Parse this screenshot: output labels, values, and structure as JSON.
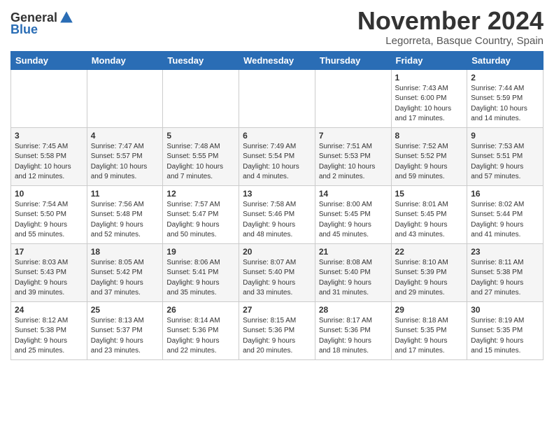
{
  "logo": {
    "general": "General",
    "blue": "Blue"
  },
  "title": "November 2024",
  "location": "Legorreta, Basque Country, Spain",
  "days_of_week": [
    "Sunday",
    "Monday",
    "Tuesday",
    "Wednesday",
    "Thursday",
    "Friday",
    "Saturday"
  ],
  "weeks": [
    [
      {
        "day": "",
        "info": ""
      },
      {
        "day": "",
        "info": ""
      },
      {
        "day": "",
        "info": ""
      },
      {
        "day": "",
        "info": ""
      },
      {
        "day": "",
        "info": ""
      },
      {
        "day": "1",
        "info": "Sunrise: 7:43 AM\nSunset: 6:00 PM\nDaylight: 10 hours\nand 17 minutes."
      },
      {
        "day": "2",
        "info": "Sunrise: 7:44 AM\nSunset: 5:59 PM\nDaylight: 10 hours\nand 14 minutes."
      }
    ],
    [
      {
        "day": "3",
        "info": "Sunrise: 7:45 AM\nSunset: 5:58 PM\nDaylight: 10 hours\nand 12 minutes."
      },
      {
        "day": "4",
        "info": "Sunrise: 7:47 AM\nSunset: 5:57 PM\nDaylight: 10 hours\nand 9 minutes."
      },
      {
        "day": "5",
        "info": "Sunrise: 7:48 AM\nSunset: 5:55 PM\nDaylight: 10 hours\nand 7 minutes."
      },
      {
        "day": "6",
        "info": "Sunrise: 7:49 AM\nSunset: 5:54 PM\nDaylight: 10 hours\nand 4 minutes."
      },
      {
        "day": "7",
        "info": "Sunrise: 7:51 AM\nSunset: 5:53 PM\nDaylight: 10 hours\nand 2 minutes."
      },
      {
        "day": "8",
        "info": "Sunrise: 7:52 AM\nSunset: 5:52 PM\nDaylight: 9 hours\nand 59 minutes."
      },
      {
        "day": "9",
        "info": "Sunrise: 7:53 AM\nSunset: 5:51 PM\nDaylight: 9 hours\nand 57 minutes."
      }
    ],
    [
      {
        "day": "10",
        "info": "Sunrise: 7:54 AM\nSunset: 5:50 PM\nDaylight: 9 hours\nand 55 minutes."
      },
      {
        "day": "11",
        "info": "Sunrise: 7:56 AM\nSunset: 5:48 PM\nDaylight: 9 hours\nand 52 minutes."
      },
      {
        "day": "12",
        "info": "Sunrise: 7:57 AM\nSunset: 5:47 PM\nDaylight: 9 hours\nand 50 minutes."
      },
      {
        "day": "13",
        "info": "Sunrise: 7:58 AM\nSunset: 5:46 PM\nDaylight: 9 hours\nand 48 minutes."
      },
      {
        "day": "14",
        "info": "Sunrise: 8:00 AM\nSunset: 5:45 PM\nDaylight: 9 hours\nand 45 minutes."
      },
      {
        "day": "15",
        "info": "Sunrise: 8:01 AM\nSunset: 5:45 PM\nDaylight: 9 hours\nand 43 minutes."
      },
      {
        "day": "16",
        "info": "Sunrise: 8:02 AM\nSunset: 5:44 PM\nDaylight: 9 hours\nand 41 minutes."
      }
    ],
    [
      {
        "day": "17",
        "info": "Sunrise: 8:03 AM\nSunset: 5:43 PM\nDaylight: 9 hours\nand 39 minutes."
      },
      {
        "day": "18",
        "info": "Sunrise: 8:05 AM\nSunset: 5:42 PM\nDaylight: 9 hours\nand 37 minutes."
      },
      {
        "day": "19",
        "info": "Sunrise: 8:06 AM\nSunset: 5:41 PM\nDaylight: 9 hours\nand 35 minutes."
      },
      {
        "day": "20",
        "info": "Sunrise: 8:07 AM\nSunset: 5:40 PM\nDaylight: 9 hours\nand 33 minutes."
      },
      {
        "day": "21",
        "info": "Sunrise: 8:08 AM\nSunset: 5:40 PM\nDaylight: 9 hours\nand 31 minutes."
      },
      {
        "day": "22",
        "info": "Sunrise: 8:10 AM\nSunset: 5:39 PM\nDaylight: 9 hours\nand 29 minutes."
      },
      {
        "day": "23",
        "info": "Sunrise: 8:11 AM\nSunset: 5:38 PM\nDaylight: 9 hours\nand 27 minutes."
      }
    ],
    [
      {
        "day": "24",
        "info": "Sunrise: 8:12 AM\nSunset: 5:38 PM\nDaylight: 9 hours\nand 25 minutes."
      },
      {
        "day": "25",
        "info": "Sunrise: 8:13 AM\nSunset: 5:37 PM\nDaylight: 9 hours\nand 23 minutes."
      },
      {
        "day": "26",
        "info": "Sunrise: 8:14 AM\nSunset: 5:36 PM\nDaylight: 9 hours\nand 22 minutes."
      },
      {
        "day": "27",
        "info": "Sunrise: 8:15 AM\nSunset: 5:36 PM\nDaylight: 9 hours\nand 20 minutes."
      },
      {
        "day": "28",
        "info": "Sunrise: 8:17 AM\nSunset: 5:36 PM\nDaylight: 9 hours\nand 18 minutes."
      },
      {
        "day": "29",
        "info": "Sunrise: 8:18 AM\nSunset: 5:35 PM\nDaylight: 9 hours\nand 17 minutes."
      },
      {
        "day": "30",
        "info": "Sunrise: 8:19 AM\nSunset: 5:35 PM\nDaylight: 9 hours\nand 15 minutes."
      }
    ]
  ]
}
